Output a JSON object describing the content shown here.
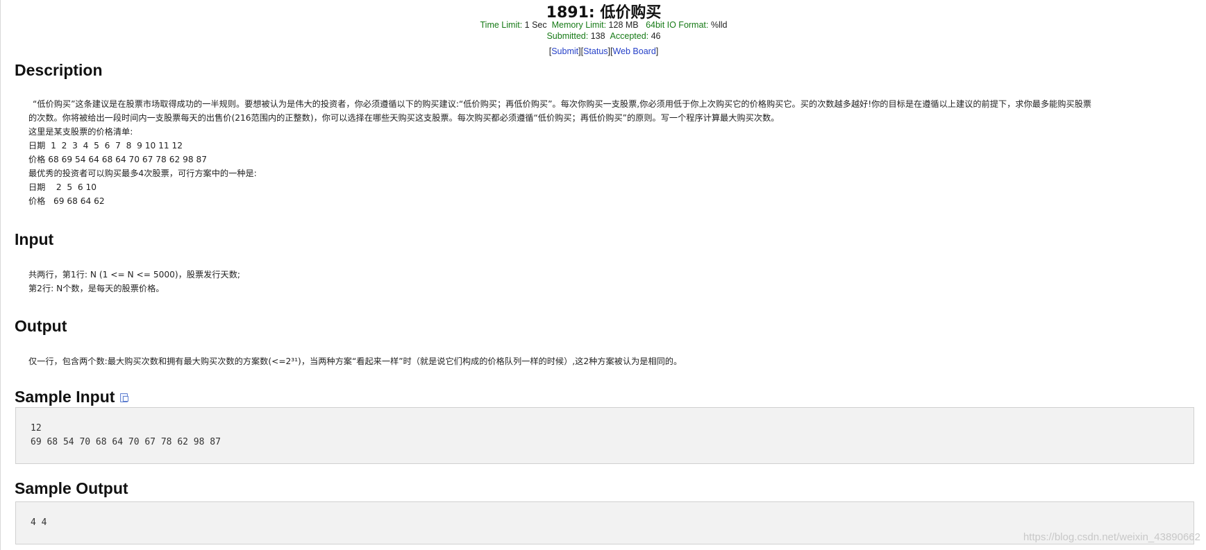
{
  "header": {
    "title": "1891: 低价购买",
    "time_limit_label": "Time Limit:",
    "time_limit_value": "1 Sec",
    "memory_limit_label": "Memory Limit:",
    "memory_limit_value": "128 MB",
    "io_format_label": "64bit IO Format:",
    "io_format_value": "%lld",
    "submitted_label": "Submitted:",
    "submitted_value": "138",
    "accepted_label": "Accepted:",
    "accepted_value": "46",
    "links": {
      "submit": "Submit",
      "status": "Status",
      "web_board": "Web Board"
    }
  },
  "description": {
    "heading": "Description",
    "lines": [
      "“低价购买”这条建议是在股票市场取得成功的一半规则。要想被认为是伟大的投资者，你必须遵循以下的购买建议:“低价购买；再低价购买”。每次你购买一支股票,你必须用低于你上次购买它的价格购买它。买的次数越多越好!你的目标是在遵循以上建议的前提下，求你最多能购买股票",
      "的次数。你将被给出一段时间内一支股票每天的出售价(216范围内的正整数)，你可以选择在哪些天购买这支股票。每次购买都必须遵循“低价购买；再低价购买”的原则。写一个程序计算最大购买次数。",
      "这里是某支股票的价格清单:",
      "日期  1  2  3  4  5  6  7  8  9 10 11 12",
      "价格 68 69 54 64 68 64 70 67 78 62 98 87",
      "最优秀的投资者可以购买最多4次股票，可行方案中的一种是:",
      "日期    2  5  6 10",
      "价格   69 68 64 62"
    ]
  },
  "input": {
    "heading": "Input",
    "lines": [
      "共两行，第1行: N (1 <= N <= 5000)，股票发行天数;",
      "第2行: N个数，是每天的股票价格。"
    ]
  },
  "output": {
    "heading": "Output",
    "line": "仅一行，包含两个数:最大购买次数和拥有最大购买次数的方案数(<=2³¹)，当两种方案“看起来一样”时（就是说它们构成的价格队列一样的时候）,这2种方案被认为是相同的。"
  },
  "sample_input": {
    "heading": "Sample Input",
    "line1": "12",
    "line2": "69 68 54 70 68 64 70 67 78 62 98 87"
  },
  "sample_output": {
    "heading": "Sample Output",
    "line1": "4 4"
  },
  "watermark": "https://blog.csdn.net/weixin_43890662",
  "colors": {
    "label_green": "#167a16",
    "link_blue": "#2540c8",
    "code_bg": "#f2f2f2"
  }
}
